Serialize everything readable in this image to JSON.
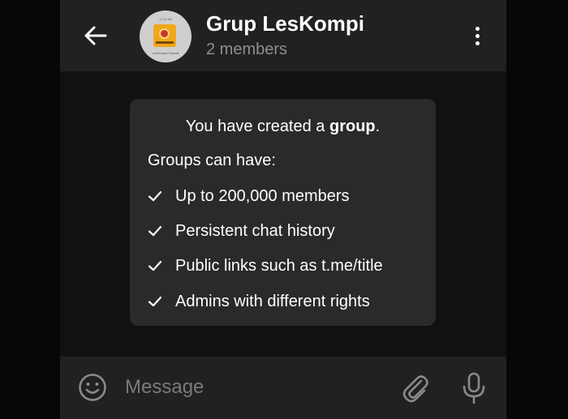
{
  "header": {
    "title": "Grup LesKompi",
    "subtitle": "2 members",
    "avatar": {
      "top_text": "ⓔ Ex.Mit",
      "caption": "LesKompi Podcast"
    }
  },
  "service_message": {
    "title_prefix": "You have created a ",
    "title_bold": "group",
    "title_suffix": ".",
    "subheading": "Groups can have:",
    "features": [
      "Up to 200,000 members",
      "Persistent chat history",
      "Public links such as t.me/title",
      "Admins with different rights"
    ]
  },
  "input": {
    "placeholder": "Message"
  },
  "icons": {
    "back": "arrow-left-icon",
    "menu": "more-vertical-icon",
    "check": "check-icon",
    "emoji": "smiley-icon",
    "attach": "paperclip-icon",
    "mic": "microphone-icon"
  },
  "colors": {
    "background": "#111111",
    "header": "#212121",
    "card": "#2a2a2a",
    "text": "#ffffff",
    "muted": "#8e8e8e",
    "icon_muted": "#8a8a8a"
  }
}
